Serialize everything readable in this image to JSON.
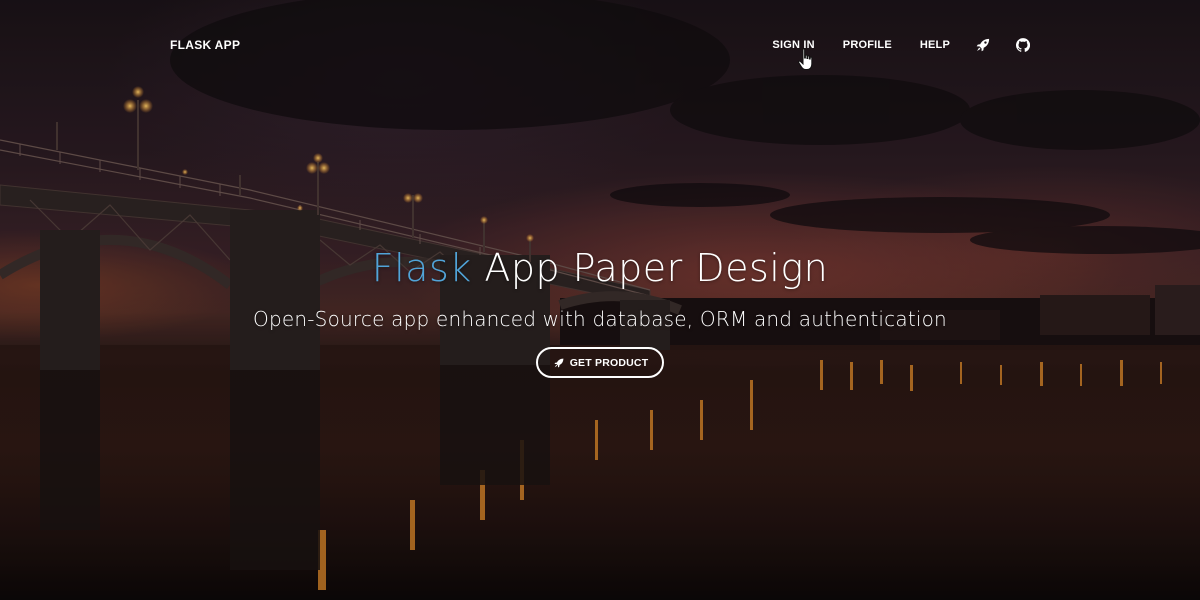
{
  "navbar": {
    "brand": "FLASK APP",
    "links": [
      {
        "label": "SIGN IN"
      },
      {
        "label": "PROFILE"
      },
      {
        "label": "HELP"
      }
    ],
    "icons": [
      {
        "name": "rocket-icon"
      },
      {
        "name": "github-icon"
      }
    ]
  },
  "hero": {
    "title_accent": "Flask",
    "title_rest": " App Paper Design",
    "subtitle": "Open-Source app enhanced with database, ORM and authentication",
    "cta_label": "GET PRODUCT",
    "cta_icon": "rocket-icon"
  },
  "colors": {
    "accent": "#51a4d8",
    "text": "#ffffff"
  }
}
